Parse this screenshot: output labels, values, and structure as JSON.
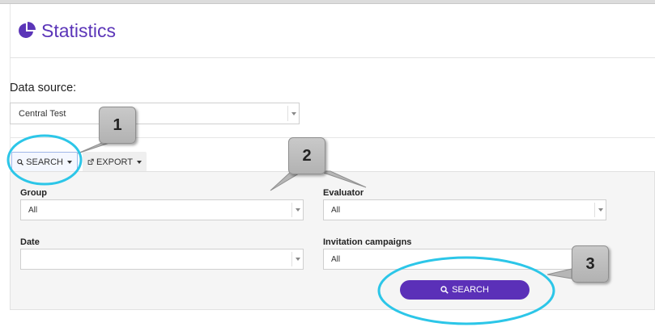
{
  "page": {
    "title": "Statistics"
  },
  "data_source": {
    "label": "Data source:",
    "value": "Central Test"
  },
  "toolbar": {
    "search_label": "SEARCH",
    "export_label": "EXPORT"
  },
  "filters": {
    "group": {
      "label": "Group",
      "value": "All"
    },
    "evaluator": {
      "label": "Evaluator",
      "value": "All"
    },
    "date": {
      "label": "Date",
      "value": ""
    },
    "invitation_campaigns": {
      "label": "Invitation campaigns",
      "value": "All"
    }
  },
  "actions": {
    "search_label": "SEARCH"
  },
  "callouts": {
    "one": "1",
    "two": "2",
    "three": "3"
  },
  "colors": {
    "accent": "#5b30b8",
    "highlight": "#2cc6e8",
    "callout": "#bdbdbd"
  },
  "icons": {
    "title": "pie-chart-icon",
    "search": "magnifier-icon",
    "export": "external-link-icon",
    "dropdown": "caret-down-icon"
  }
}
